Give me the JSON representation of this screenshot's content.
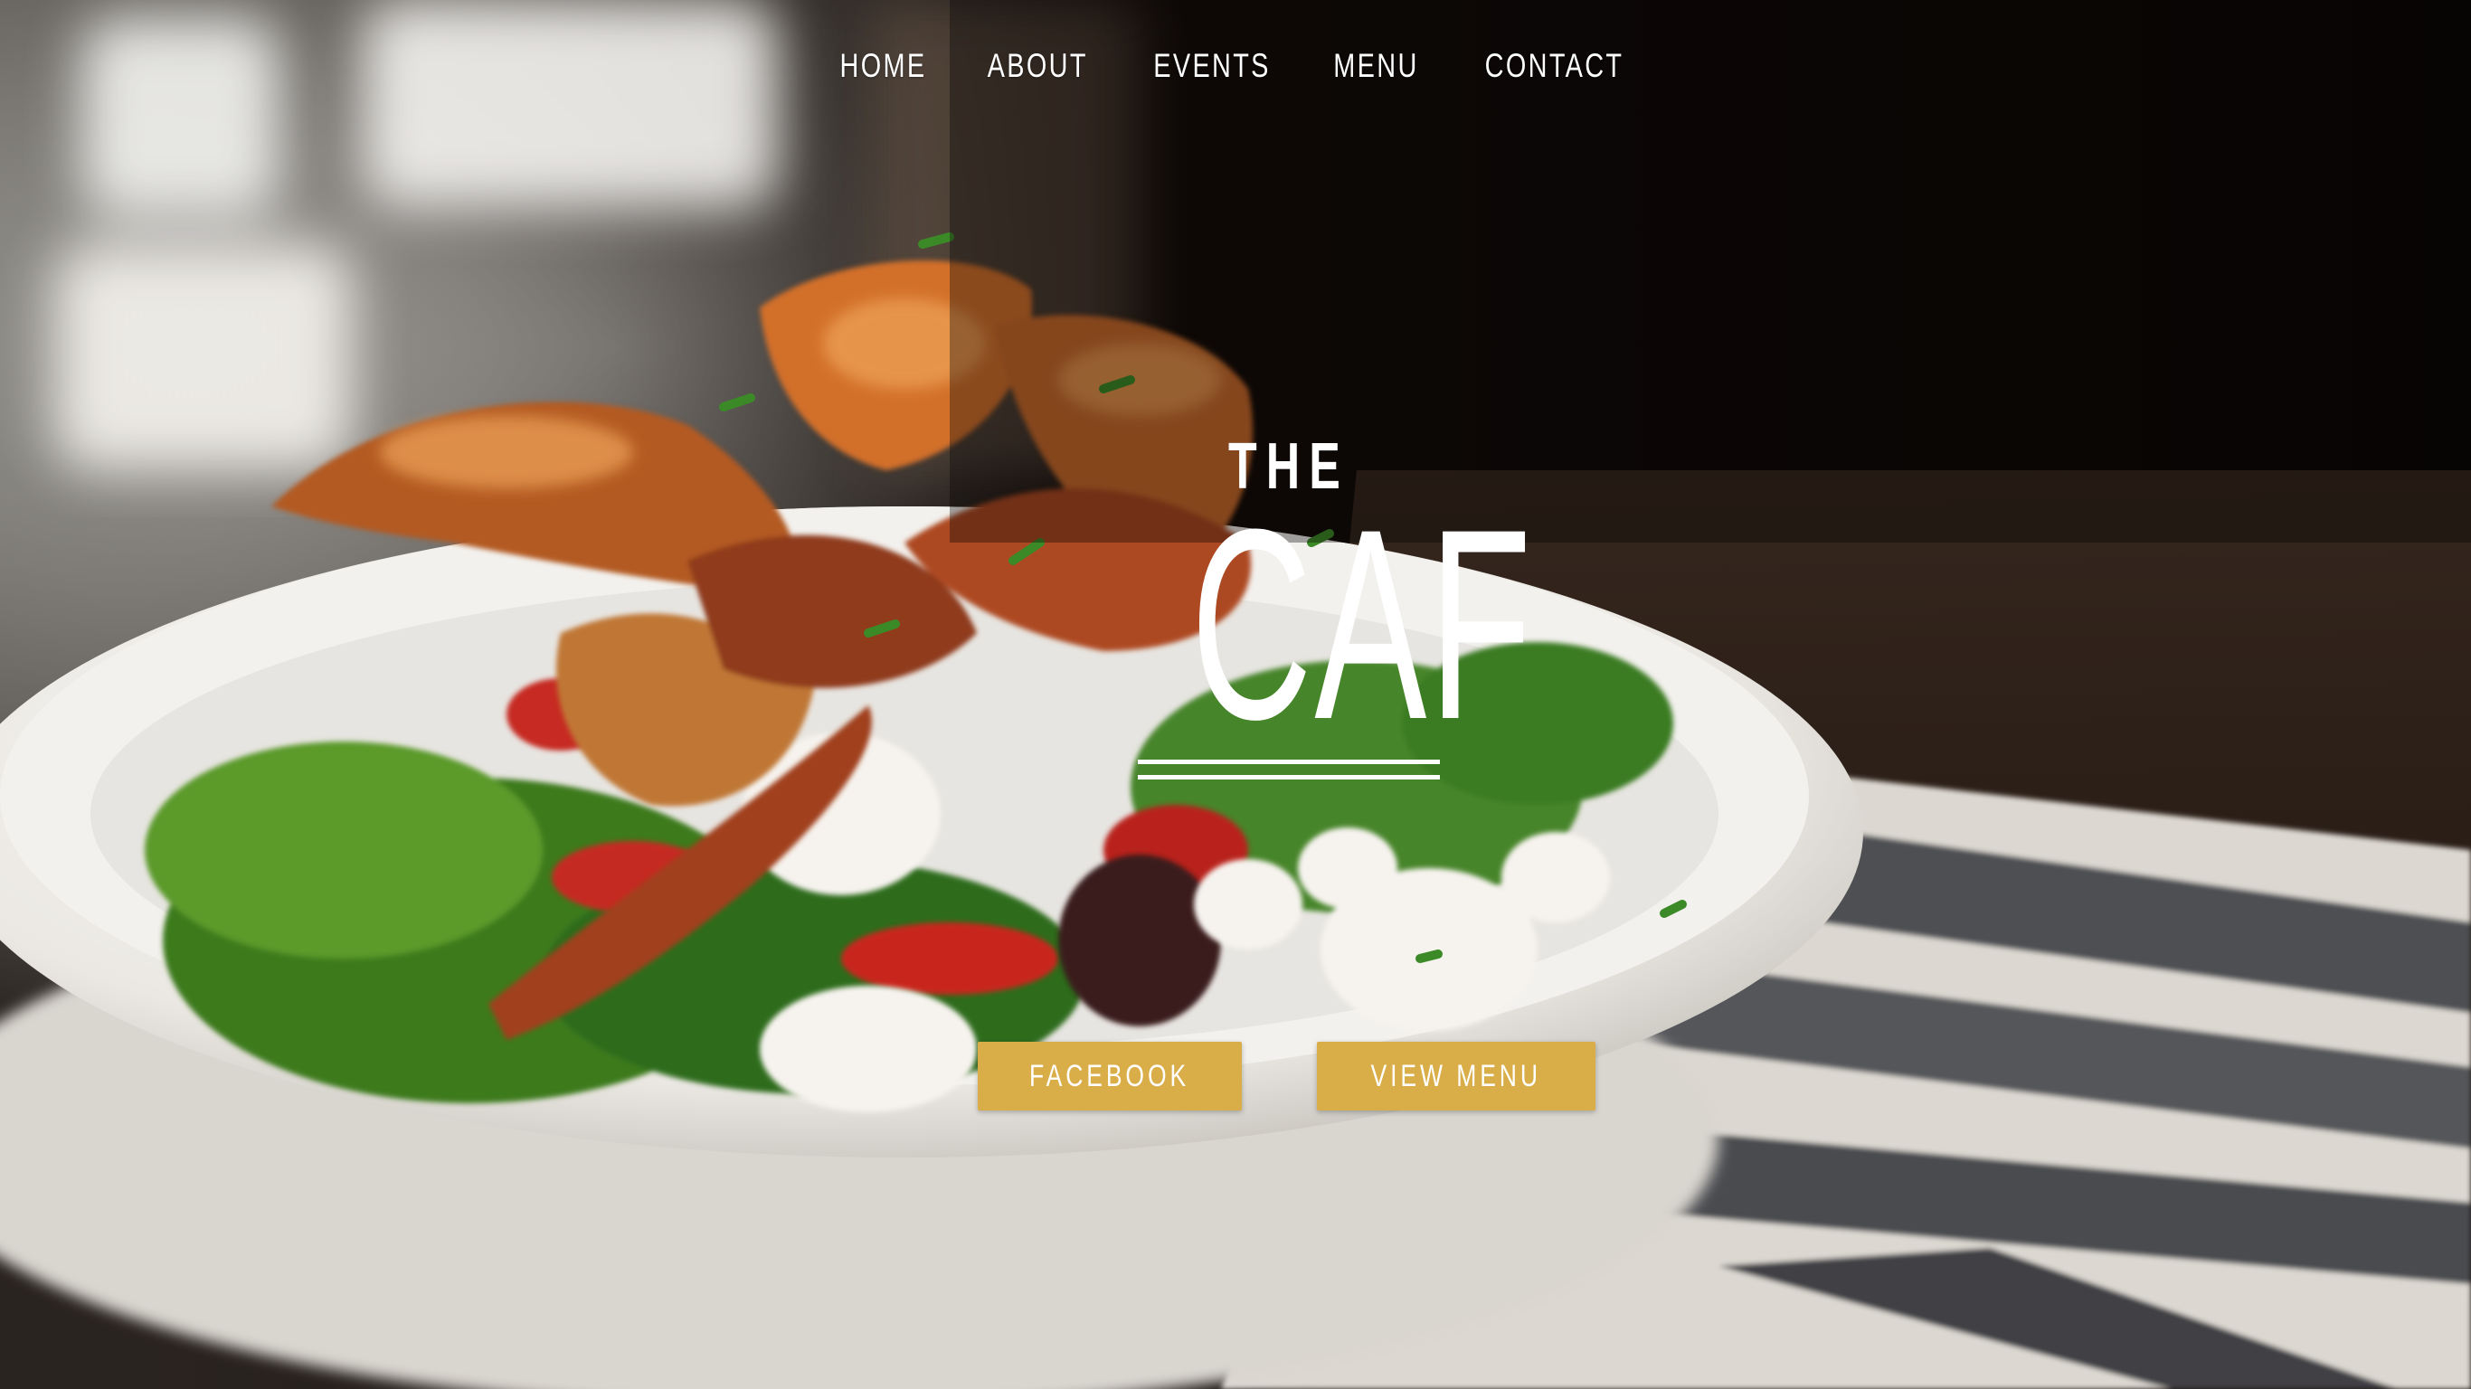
{
  "nav": {
    "items": [
      {
        "label": "HOME"
      },
      {
        "label": "ABOUT"
      },
      {
        "label": "EVENTS"
      },
      {
        "label": "MENU"
      },
      {
        "label": "CONTACT"
      }
    ]
  },
  "logo": {
    "the": "THE",
    "name": "CAF"
  },
  "buttons": {
    "facebook": "FACEBOOK",
    "view_menu": "VIEW MENU"
  },
  "colors": {
    "button_background": "#d9ad48",
    "text": "#ffffff"
  }
}
